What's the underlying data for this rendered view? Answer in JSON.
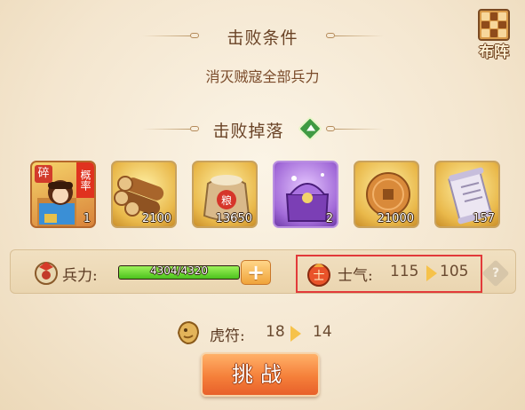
{
  "defeat_condition": {
    "title": "击败条件",
    "description": "消灭贼寇全部兵力"
  },
  "deploy_button": {
    "label": "布阵"
  },
  "defeat_drops": {
    "title": "击败掉落",
    "items": [
      {
        "name": "hero-fragment",
        "count": "1",
        "tag_fragment": "碎",
        "tag_probability": "概率"
      },
      {
        "name": "wood",
        "count": "2100"
      },
      {
        "name": "grain-sack",
        "count": "13650",
        "stamp": "粮"
      },
      {
        "name": "purple-chest",
        "count": "2"
      },
      {
        "name": "copper-coin",
        "count": "21000"
      },
      {
        "name": "scroll",
        "count": "157"
      }
    ]
  },
  "troops": {
    "label": "兵力",
    "colon": ":",
    "value_text": "4304/4320",
    "current": 4304,
    "max": 4320,
    "plus_label": "+"
  },
  "morale": {
    "label": "士气",
    "colon": ":",
    "current": "115",
    "after": "105"
  },
  "tiger_tally": {
    "label": "虎符",
    "colon": ":",
    "current": "18",
    "after": "14"
  },
  "challenge_button": {
    "label": "挑战"
  },
  "help_icon": {
    "glyph": "?"
  },
  "colors": {
    "highlight_border": "#e23a3a",
    "button_orange": "#f5803a",
    "hp_green": "#4cc21d"
  }
}
